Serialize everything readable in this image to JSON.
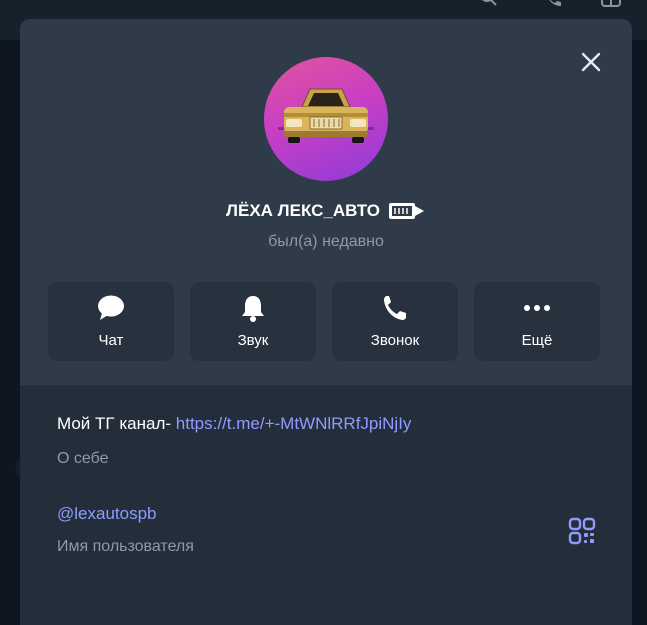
{
  "profile": {
    "name": "ЛЁХА ЛЕКС_АВТО",
    "status": "был(а) недавно"
  },
  "actions": [
    {
      "label": "Чат",
      "icon": "chat-bubble-icon"
    },
    {
      "label": "Звук",
      "icon": "bell-icon"
    },
    {
      "label": "Звонок",
      "icon": "phone-icon"
    },
    {
      "label": "Ещё",
      "icon": "more-dots-icon"
    }
  ],
  "info": {
    "bio_prefix": "Мой ТГ канал- ",
    "bio_link": "https://t.me/+-MtWNlRRfJpiNjIy",
    "bio_caption": "О себе",
    "username": "@lexautospb",
    "username_caption": "Имя пользователя"
  },
  "colors": {
    "modal": "#2f3b48",
    "action_tile": "#27323e",
    "info_panel": "#232e3a",
    "link": "#8f9bff",
    "secondary_text": "#8e9aa6"
  }
}
